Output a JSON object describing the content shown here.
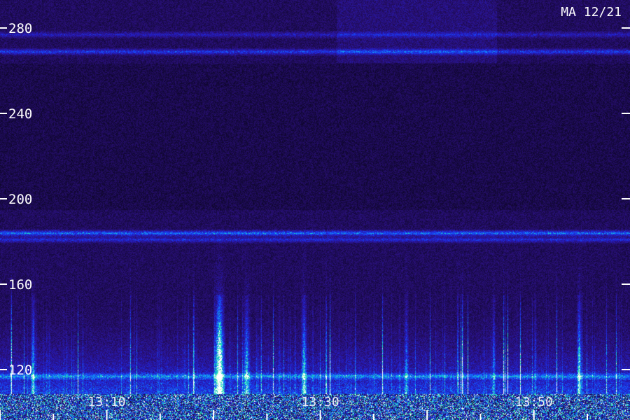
{
  "chart_data": {
    "type": "heatmap",
    "corner_label": "MA 12/21",
    "y_ticks": [
      120,
      160,
      200,
      240,
      280
    ],
    "y_range": [
      100,
      290
    ],
    "x_ticks": [
      "13:10",
      "13:30",
      "13:50"
    ],
    "x_range_minutes": [
      13.0,
      13.9833
    ],
    "colormap": [
      "#000000",
      "#1a0a4a",
      "#2a0f7a",
      "#2020c0",
      "#1050ff",
      "#10c0e0",
      "#20f0a0",
      "#ffffff"
    ],
    "bright_bands": [
      {
        "y": 277,
        "intensity": 0.45
      },
      {
        "y": 269,
        "intensity": 0.7
      },
      {
        "y": 184,
        "intensity": 0.9
      },
      {
        "y": 181,
        "intensity": 0.6
      },
      {
        "y": 117,
        "intensity": 0.55
      }
    ]
  }
}
